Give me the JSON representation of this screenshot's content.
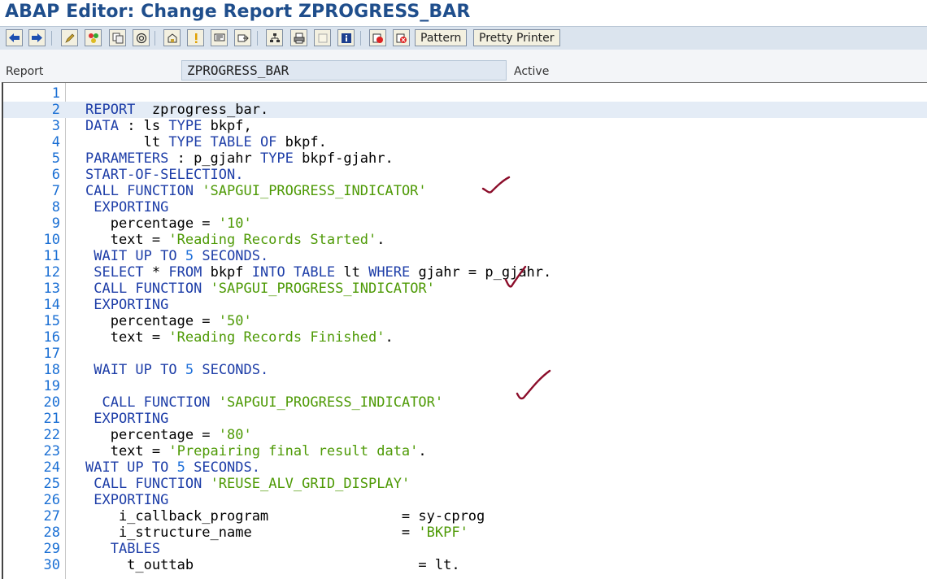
{
  "window": {
    "title": "ABAP Editor: Change Report ZPROGRESS_BAR"
  },
  "toolbar": {
    "icons": [
      "arrow-left-icon",
      "arrow-right-icon",
      "pencil-icon",
      "syntax-check-icon",
      "display-object-icon",
      "activate-icon",
      "where-used-icon",
      "mark-icon",
      "lightbulb-icon",
      "pattern-icon",
      "transport-icon",
      "hierarchy-icon",
      "print-icon",
      "blank-icon",
      "info-icon",
      "breakpoint-set-icon",
      "breakpoint-delete-icon"
    ],
    "pattern_label": "Pattern",
    "pretty_printer_label": "Pretty Printer"
  },
  "header": {
    "report_label": "Report",
    "report_value": "ZPROGRESS_BAR",
    "status": "Active"
  },
  "editor": {
    "current_line": 2,
    "lines": [
      {
        "n": "1",
        "tokens": []
      },
      {
        "n": "2",
        "tokens": [
          [
            "kw",
            "REPORT"
          ],
          [
            "t",
            "  zprogress_bar."
          ]
        ]
      },
      {
        "n": "3",
        "tokens": [
          [
            "kw",
            "DATA"
          ],
          [
            "t",
            " : ls "
          ],
          [
            "kw",
            "TYPE"
          ],
          [
            "t",
            " bkpf,"
          ]
        ]
      },
      {
        "n": "4",
        "tokens": [
          [
            "t",
            "       lt "
          ],
          [
            "kw",
            "TYPE TABLE OF"
          ],
          [
            "t",
            " bkpf."
          ]
        ]
      },
      {
        "n": "5",
        "tokens": [
          [
            "kw",
            "PARAMETERS"
          ],
          [
            "t",
            " : p_gjahr "
          ],
          [
            "kw",
            "TYPE"
          ],
          [
            "t",
            " bkpf-gjahr."
          ]
        ]
      },
      {
        "n": "6",
        "tokens": [
          [
            "kw",
            "START-OF-SELECTION."
          ]
        ]
      },
      {
        "n": "7",
        "tokens": [
          [
            "kw",
            "CALL FUNCTION"
          ],
          [
            "t",
            " "
          ],
          [
            "str",
            "'SAPGUI_PROGRESS_INDICATOR'"
          ]
        ]
      },
      {
        "n": "8",
        "tokens": [
          [
            "t",
            " "
          ],
          [
            "kw",
            "EXPORTING"
          ]
        ]
      },
      {
        "n": "9",
        "tokens": [
          [
            "t",
            "   percentage = "
          ],
          [
            "str",
            "'10'"
          ]
        ]
      },
      {
        "n": "10",
        "tokens": [
          [
            "t",
            "   text = "
          ],
          [
            "str",
            "'Reading Records Started'"
          ],
          [
            "t",
            "."
          ]
        ]
      },
      {
        "n": "11",
        "tokens": [
          [
            "t",
            " "
          ],
          [
            "kw",
            "WAIT UP TO"
          ],
          [
            "t",
            " "
          ],
          [
            "num",
            "5"
          ],
          [
            "t",
            " "
          ],
          [
            "kw",
            "SECONDS."
          ]
        ]
      },
      {
        "n": "12",
        "tokens": [
          [
            "t",
            " "
          ],
          [
            "kw",
            "SELECT"
          ],
          [
            "t",
            " * "
          ],
          [
            "kw",
            "FROM"
          ],
          [
            "t",
            " bkpf "
          ],
          [
            "kw",
            "INTO TABLE"
          ],
          [
            "t",
            " lt "
          ],
          [
            "kw",
            "WHERE"
          ],
          [
            "t",
            " gjahr = p_gjahr."
          ]
        ]
      },
      {
        "n": "13",
        "tokens": [
          [
            "t",
            " "
          ],
          [
            "kw",
            "CALL FUNCTION"
          ],
          [
            "t",
            " "
          ],
          [
            "str",
            "'SAPGUI_PROGRESS_INDICATOR'"
          ]
        ]
      },
      {
        "n": "14",
        "tokens": [
          [
            "t",
            " "
          ],
          [
            "kw",
            "EXPORTING"
          ]
        ]
      },
      {
        "n": "15",
        "tokens": [
          [
            "t",
            "   percentage = "
          ],
          [
            "str",
            "'50'"
          ]
        ]
      },
      {
        "n": "16",
        "tokens": [
          [
            "t",
            "   text = "
          ],
          [
            "str",
            "'Reading Records Finished'"
          ],
          [
            "t",
            "."
          ]
        ]
      },
      {
        "n": "17",
        "tokens": []
      },
      {
        "n": "18",
        "tokens": [
          [
            "t",
            " "
          ],
          [
            "kw",
            "WAIT UP TO"
          ],
          [
            "t",
            " "
          ],
          [
            "num",
            "5"
          ],
          [
            "t",
            " "
          ],
          [
            "kw",
            "SECONDS."
          ]
        ]
      },
      {
        "n": "19",
        "tokens": []
      },
      {
        "n": "20",
        "tokens": [
          [
            "t",
            "  "
          ],
          [
            "kw",
            "CALL FUNCTION"
          ],
          [
            "t",
            " "
          ],
          [
            "str",
            "'SAPGUI_PROGRESS_INDICATOR'"
          ]
        ]
      },
      {
        "n": "21",
        "tokens": [
          [
            "t",
            " "
          ],
          [
            "kw",
            "EXPORTING"
          ]
        ]
      },
      {
        "n": "22",
        "tokens": [
          [
            "t",
            "   percentage = "
          ],
          [
            "str",
            "'80'"
          ]
        ]
      },
      {
        "n": "23",
        "tokens": [
          [
            "t",
            "   text = "
          ],
          [
            "str",
            "'Prepairing final result data'"
          ],
          [
            "t",
            "."
          ]
        ]
      },
      {
        "n": "24",
        "tokens": [
          [
            "kw",
            "WAIT UP TO"
          ],
          [
            "t",
            " "
          ],
          [
            "num",
            "5"
          ],
          [
            "t",
            " "
          ],
          [
            "kw",
            "SECONDS."
          ]
        ]
      },
      {
        "n": "25",
        "tokens": [
          [
            "t",
            " "
          ],
          [
            "kw",
            "CALL FUNCTION"
          ],
          [
            "t",
            " "
          ],
          [
            "str",
            "'REUSE_ALV_GRID_DISPLAY'"
          ]
        ]
      },
      {
        "n": "26",
        "tokens": [
          [
            "t",
            " "
          ],
          [
            "kw",
            "EXPORTING"
          ]
        ]
      },
      {
        "n": "27",
        "tokens": [
          [
            "t",
            "    i_callback_program                = sy-cprog"
          ]
        ]
      },
      {
        "n": "28",
        "tokens": [
          [
            "t",
            "    i_structure_name                  = "
          ],
          [
            "str",
            "'BKPF'"
          ]
        ]
      },
      {
        "n": "29",
        "tokens": [
          [
            "t",
            "   "
          ],
          [
            "kw",
            "TABLES"
          ]
        ]
      },
      {
        "n": "30",
        "tokens": [
          [
            "t",
            "     t_outtab                           = lt."
          ]
        ]
      }
    ]
  },
  "colors": {
    "title": "#1f4e8c",
    "keyword": "#1e3ea8",
    "string": "#4e9a06",
    "number": "#1e6fd9",
    "line_number": "#1a6fd4",
    "annotation": "#8b0d2a"
  }
}
